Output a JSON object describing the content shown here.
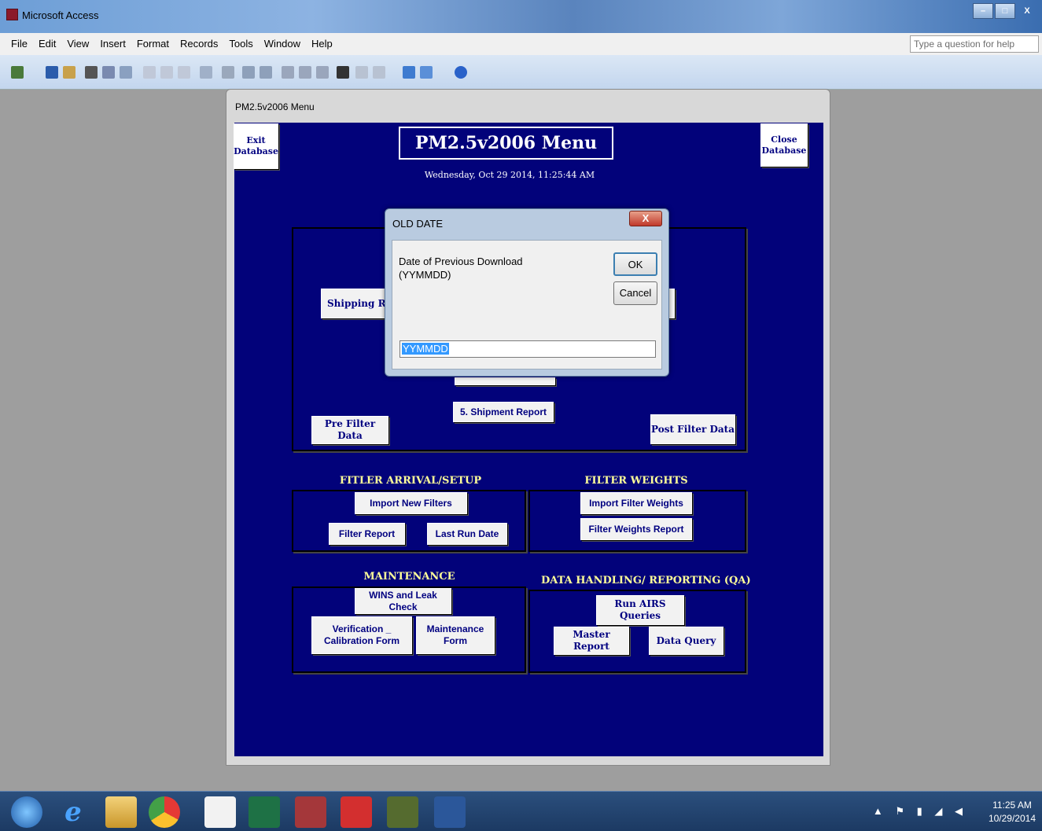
{
  "window": {
    "title": "Microsoft Access",
    "controls": [
      "–",
      "□",
      "X"
    ]
  },
  "menu": {
    "items": [
      "File",
      "Edit",
      "View",
      "Insert",
      "Format",
      "Records",
      "Tools",
      "Window",
      "Help"
    ],
    "help_placeholder": "Type a question for help"
  },
  "child_window": {
    "title": "PM2.5v2006 Menu"
  },
  "form": {
    "title": "PM2.5v2006 Menu",
    "datetime": "Wednesday, Oct 29 2014, 11:25:44 AM",
    "exit_button": "Exit Database",
    "close_button": "Close Database",
    "shipping_button": "Shipping Re",
    "shipment_report_button": "5. Shipment Report",
    "pre_filter_button": "Pre Filter Data",
    "post_filter_button": "Post Filter Data",
    "sections": {
      "arrival": {
        "heading": "FITLER ARRIVAL/SETUP",
        "import_new_filters": "Import New Filters",
        "filter_report": "Filter Report",
        "last_run_date": "Last Run Date"
      },
      "weights": {
        "heading": "FILTER WEIGHTS",
        "import_filter_weights": "Import Filter Weights",
        "filter_weights_report": "Filter Weights Report"
      },
      "maintenance": {
        "heading": "MAINTENANCE",
        "wins_leak_check": "WINS and Leak Check",
        "verification_line1": "Verification _",
        "verification_line2": "Calibration Form",
        "maintenance_line1": "Maintenance",
        "maintenance_line2": "Form"
      },
      "data_handling": {
        "heading": "DATA HANDLING/ REPORTING (QA)",
        "run_airs_queries": "Run AIRS Queries",
        "master_report": "Master Report",
        "data_query": "Data Query"
      }
    }
  },
  "dialog": {
    "title": "OLD DATE",
    "close": "X",
    "prompt_line1": "Date of Previous Download",
    "prompt_line2": "(YYMMDD)",
    "ok": "OK",
    "cancel": "Cancel",
    "input_value": "YYMMDD"
  },
  "taskbar": {
    "icons": [
      "start-orb-icon",
      "internet-explorer-icon",
      "file-explorer-icon",
      "chrome-icon",
      "grid-app-icon",
      "excel-icon",
      "access-icon",
      "acrobat-icon",
      "app-icon",
      "word-icon"
    ],
    "time": "11:25 AM",
    "date": "10/29/2014"
  }
}
